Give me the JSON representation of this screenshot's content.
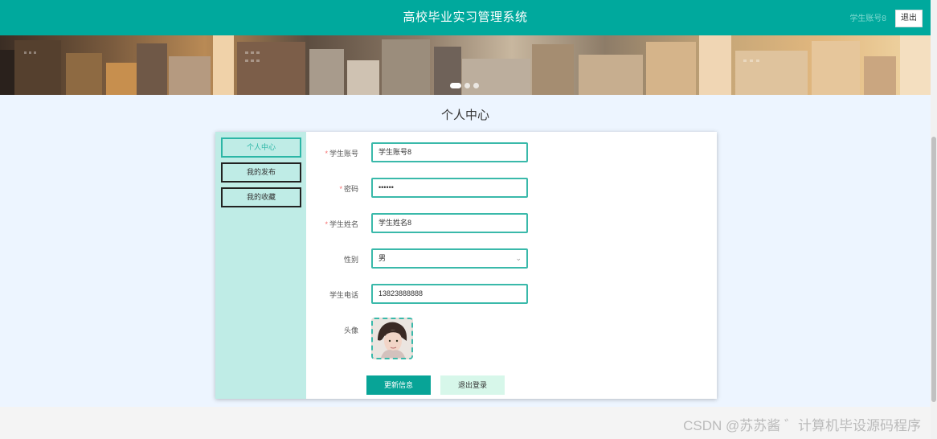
{
  "header": {
    "title": "高校毕业实习管理系统",
    "account": "学生账号8",
    "logout": "退出"
  },
  "page": {
    "title": "个人中心"
  },
  "sidebar": {
    "items": [
      {
        "label": "个人中心",
        "active": true
      },
      {
        "label": "我的发布",
        "active": false
      },
      {
        "label": "我的收藏",
        "active": false
      }
    ]
  },
  "form": {
    "account_label": "学生账号",
    "account_value": "学生账号8",
    "password_label": "密码",
    "password_value": "••••••",
    "name_label": "学生姓名",
    "name_value": "学生姓名8",
    "gender_label": "性别",
    "gender_value": "男",
    "phone_label": "学生电话",
    "phone_value": "13823888888",
    "avatar_label": "头像"
  },
  "buttons": {
    "update": "更新信息",
    "logout": "退出登录"
  },
  "watermark": "CSDN @苏苏酱 ゛计算机毕设源码程序",
  "colors": {
    "topbar": "#00a99d",
    "accent": "#3ab9aa",
    "sidebar": "#bfece6",
    "content_bg": "#edf5ff"
  }
}
